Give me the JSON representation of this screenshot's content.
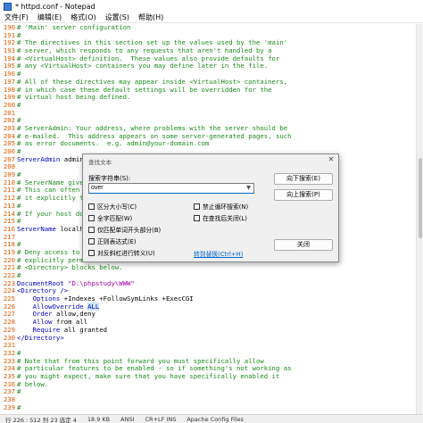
{
  "window": {
    "title": "* httpd.conf - Notepad"
  },
  "menu": [
    "文件(F)",
    "编辑(E)",
    "格式(O)",
    "设置(S)",
    "帮助(H)"
  ],
  "editor": {
    "lines": [
      {
        "n": "190",
        "segs": [
          {
            "t": "# 'Main' server configuration",
            "c": "comment"
          }
        ]
      },
      {
        "n": "191",
        "segs": [
          {
            "t": "#",
            "c": "comment"
          }
        ]
      },
      {
        "n": "192",
        "segs": [
          {
            "t": "# The directives in this section set up the values used by the 'main'",
            "c": "comment"
          }
        ]
      },
      {
        "n": "193",
        "segs": [
          {
            "t": "# server, which responds to any requests that aren't handled by a",
            "c": "comment"
          }
        ]
      },
      {
        "n": "194",
        "segs": [
          {
            "t": "# <VirtualHost> definition.  These values also provide defaults for",
            "c": "comment"
          }
        ]
      },
      {
        "n": "195",
        "segs": [
          {
            "t": "# any <VirtualHost> containers you may define later in the file.",
            "c": "comment"
          }
        ]
      },
      {
        "n": "196",
        "segs": [
          {
            "t": "#",
            "c": "comment"
          }
        ]
      },
      {
        "n": "197",
        "segs": [
          {
            "t": "# All of these directives may appear inside <VirtualHost> containers,",
            "c": "comment"
          }
        ]
      },
      {
        "n": "198",
        "segs": [
          {
            "t": "# in which case these default settings will be overridden for the",
            "c": "comment"
          }
        ]
      },
      {
        "n": "199",
        "segs": [
          {
            "t": "# virtual host being defined.",
            "c": "comment"
          }
        ]
      },
      {
        "n": "200",
        "segs": [
          {
            "t": "#",
            "c": "comment"
          }
        ]
      },
      {
        "n": "201",
        "segs": []
      },
      {
        "n": "202",
        "segs": [
          {
            "t": "#",
            "c": "comment"
          }
        ]
      },
      {
        "n": "203",
        "segs": [
          {
            "t": "# ServerAdmin: Your address, where problems with the server should be",
            "c": "comment"
          }
        ]
      },
      {
        "n": "204",
        "segs": [
          {
            "t": "# e-mailed.  This address appears on some server-generated pages, such",
            "c": "comment"
          }
        ]
      },
      {
        "n": "205",
        "segs": [
          {
            "t": "# as error documents.  e.g. admin@your-domain.com",
            "c": "comment"
          }
        ]
      },
      {
        "n": "206",
        "segs": [
          {
            "t": "#",
            "c": "comment"
          }
        ]
      },
      {
        "n": "207",
        "segs": [
          {
            "t": "ServerAdmin",
            "c": "directive"
          },
          {
            "t": " admin",
            "c": "plain"
          }
        ]
      },
      {
        "n": "208",
        "segs": []
      },
      {
        "n": "209",
        "segs": [
          {
            "t": "#",
            "c": "comment"
          }
        ]
      },
      {
        "n": "210",
        "segs": [
          {
            "t": "# ServerName give",
            "c": "comment"
          }
        ]
      },
      {
        "n": "211",
        "segs": [
          {
            "t": "# This can often",
            "c": "comment"
          }
        ]
      },
      {
        "n": "212",
        "segs": [
          {
            "t": "# it explicitly t",
            "c": "comment"
          }
        ]
      },
      {
        "n": "213",
        "segs": [
          {
            "t": "#",
            "c": "comment"
          }
        ]
      },
      {
        "n": "214",
        "segs": [
          {
            "t": "# If your host do",
            "c": "comment"
          }
        ]
      },
      {
        "n": "215",
        "segs": [
          {
            "t": "#",
            "c": "comment"
          }
        ]
      },
      {
        "n": "216",
        "segs": [
          {
            "t": "ServerName",
            "c": "directive"
          },
          {
            "t": " localho",
            "c": "plain"
          }
        ]
      },
      {
        "n": "217",
        "segs": []
      },
      {
        "n": "218",
        "segs": [
          {
            "t": "#",
            "c": "comment"
          }
        ]
      },
      {
        "n": "219",
        "segs": [
          {
            "t": "# Deny access to",
            "c": "comment"
          }
        ]
      },
      {
        "n": "220",
        "segs": [
          {
            "t": "# explicitly perm",
            "c": "comment"
          }
        ]
      },
      {
        "n": "221",
        "segs": [
          {
            "t": "# <Directory> blocks below.",
            "c": "comment"
          }
        ]
      },
      {
        "n": "222",
        "segs": [
          {
            "t": "#",
            "c": "comment"
          }
        ]
      },
      {
        "n": "223",
        "segs": [
          {
            "t": "DocumentRoot",
            "c": "directive"
          },
          {
            "t": " ",
            "c": "plain"
          },
          {
            "t": "\"D:\\phpstudy\\WWW\"",
            "c": "string"
          }
        ]
      },
      {
        "n": "224",
        "segs": [
          {
            "t": "<Directory />",
            "c": "tag"
          }
        ]
      },
      {
        "n": "225",
        "segs": [
          {
            "t": "    Options",
            "c": "directive"
          },
          {
            "t": " +Indexes +FollowSymLinks +ExecCGI",
            "c": "plain"
          }
        ]
      },
      {
        "n": "226",
        "segs": [
          {
            "t": "    AllowOverride",
            "c": "directive"
          },
          {
            "t": " ",
            "c": "plain"
          },
          {
            "t": "ALL",
            "c": "highlight"
          }
        ]
      },
      {
        "n": "227",
        "segs": [
          {
            "t": "    Order",
            "c": "directive"
          },
          {
            "t": " allow,deny",
            "c": "plain"
          }
        ]
      },
      {
        "n": "228",
        "segs": [
          {
            "t": "    Allow",
            "c": "directive"
          },
          {
            "t": " from all",
            "c": "plain"
          }
        ]
      },
      {
        "n": "229",
        "segs": [
          {
            "t": "    Require",
            "c": "directive"
          },
          {
            "t": " all granted",
            "c": "plain"
          }
        ]
      },
      {
        "n": "230",
        "segs": [
          {
            "t": "</Directory>",
            "c": "tag"
          }
        ]
      },
      {
        "n": "231",
        "segs": []
      },
      {
        "n": "232",
        "segs": [
          {
            "t": "#",
            "c": "comment"
          }
        ]
      },
      {
        "n": "233",
        "segs": [
          {
            "t": "# Note that from this point forward you must specifically allow",
            "c": "comment"
          }
        ]
      },
      {
        "n": "234",
        "segs": [
          {
            "t": "# particular features to be enabled - so if something's not working as",
            "c": "comment"
          }
        ]
      },
      {
        "n": "235",
        "segs": [
          {
            "t": "# you might expect, make sure that you have specifically enabled it",
            "c": "comment"
          }
        ]
      },
      {
        "n": "236",
        "segs": [
          {
            "t": "# below.",
            "c": "comment"
          }
        ]
      },
      {
        "n": "237",
        "segs": [
          {
            "t": "#",
            "c": "comment"
          }
        ]
      },
      {
        "n": "238",
        "segs": []
      },
      {
        "n": "239",
        "segs": [
          {
            "t": "#",
            "c": "comment"
          }
        ]
      }
    ]
  },
  "statusbar": {
    "position": "行 226 : 512   列 23   选定 4",
    "size": "18.9 KB",
    "encoding": "ANSI",
    "eol": "CR+LF   INS",
    "language": "Apache Config Files"
  },
  "find_dialog": {
    "title": "查找文本",
    "close_glyph": "✕",
    "search_label": "搜索字符串(S):",
    "search_value": "over",
    "find_next_down": "向下搜索(E)",
    "find_next_up": "向上搜索(P)",
    "close": "关闭",
    "options_left": [
      "区分大小写(C)",
      "全字匹配(W)",
      "仅匹配单词开头部分(B)",
      "正则表达式(E)",
      "对反斜杠进行转义(U)"
    ],
    "options_right": [
      "禁止循环搜索(N)",
      "在查找后关闭(L)"
    ],
    "goto_replace": "转到替换(Ctrl+H)"
  }
}
